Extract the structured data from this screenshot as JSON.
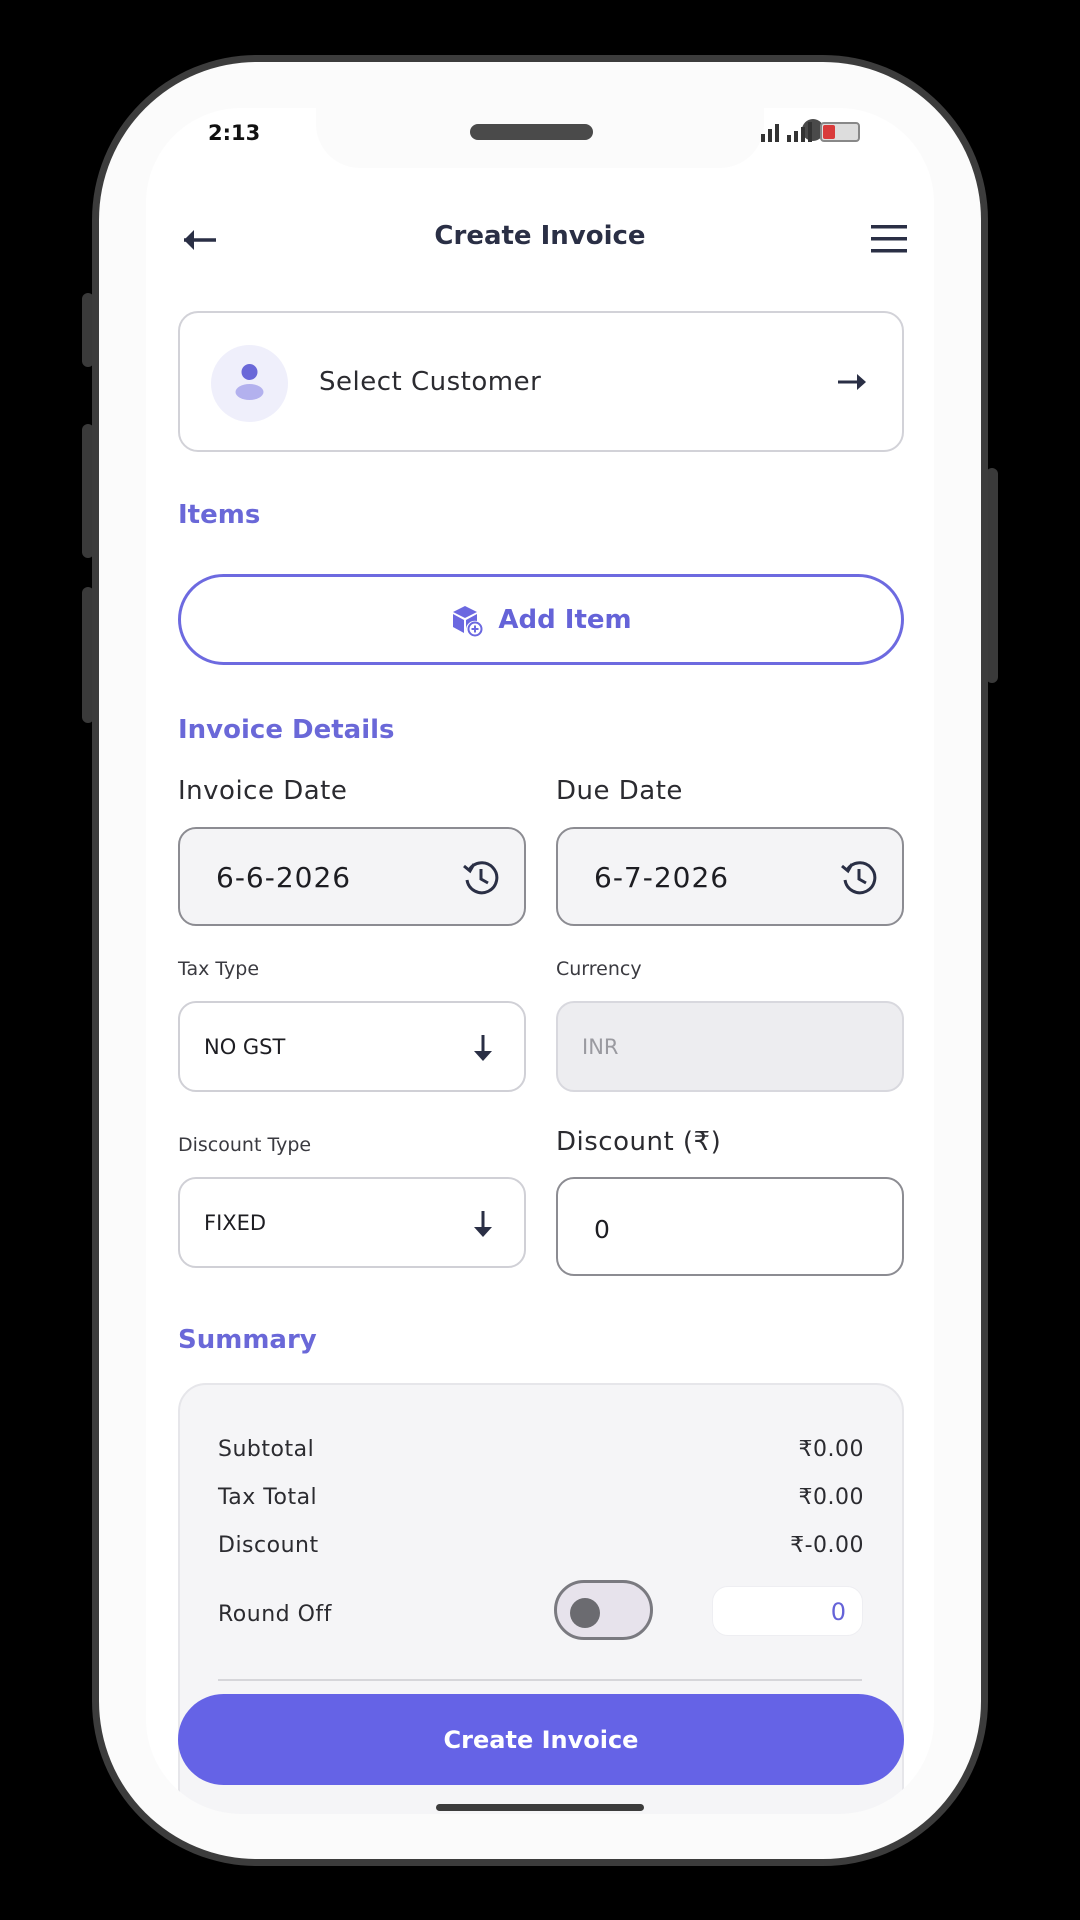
{
  "status_bar": {
    "time": "2:13"
  },
  "header": {
    "title": "Create Invoice",
    "back_icon": "arrow-left-icon",
    "menu_icon": "hamburger-menu-icon"
  },
  "customer": {
    "label": "Select Customer",
    "avatar_icon": "user-icon",
    "arrow_icon": "arrow-right-icon"
  },
  "items": {
    "section_title": "Items",
    "add_button_label": "Add Item",
    "add_icon": "box-add-icon"
  },
  "invoice_details": {
    "section_title": "Invoice Details",
    "invoice_date_label": "Invoice Date",
    "invoice_date_value": "6-6-2026",
    "due_date_label": "Due Date",
    "due_date_value": "6-7-2026",
    "date_icon": "clock-history-icon",
    "tax_type_label": "Tax Type",
    "tax_type_value": "NO GST",
    "currency_label": "Currency",
    "currency_value": "INR",
    "discount_type_label": "Discount Type",
    "discount_type_value": "FIXED",
    "discount_label": "Discount (₹)",
    "discount_value": "0",
    "select_icon": "arrow-down-icon"
  },
  "summary": {
    "section_title": "Summary",
    "subtotal_label": "Subtotal",
    "subtotal_value": "₹0.00",
    "tax_total_label": "Tax Total",
    "tax_total_value": "₹0.00",
    "discount_label": "Discount",
    "discount_value": "₹-0.00",
    "round_off_label": "Round Off",
    "round_off_enabled": false,
    "round_off_value": "0"
  },
  "actions": {
    "create_label": "Create Invoice"
  },
  "colors": {
    "accent": "#6563e6",
    "accent_text": "#6a68d8",
    "text": "#2b2b30",
    "background": "#ffffff"
  }
}
